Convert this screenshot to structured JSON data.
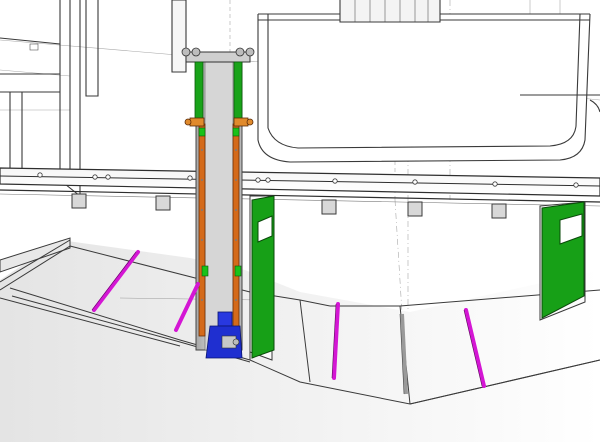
{
  "viewport": {
    "view_mode": "shaded-with-edges"
  },
  "colors": {
    "background": "#ffffff",
    "hull_edge": "#3a3a3a",
    "construction_line": "#9a9a9a",
    "tube_body": "#c9c9c9",
    "guide_rail": "#d46a1a",
    "rail_frame": "#19a319",
    "pump_unit": "#1f2fd0",
    "stiffener_highlight": "#d416d4",
    "bracket_plate": "#17a017"
  }
}
